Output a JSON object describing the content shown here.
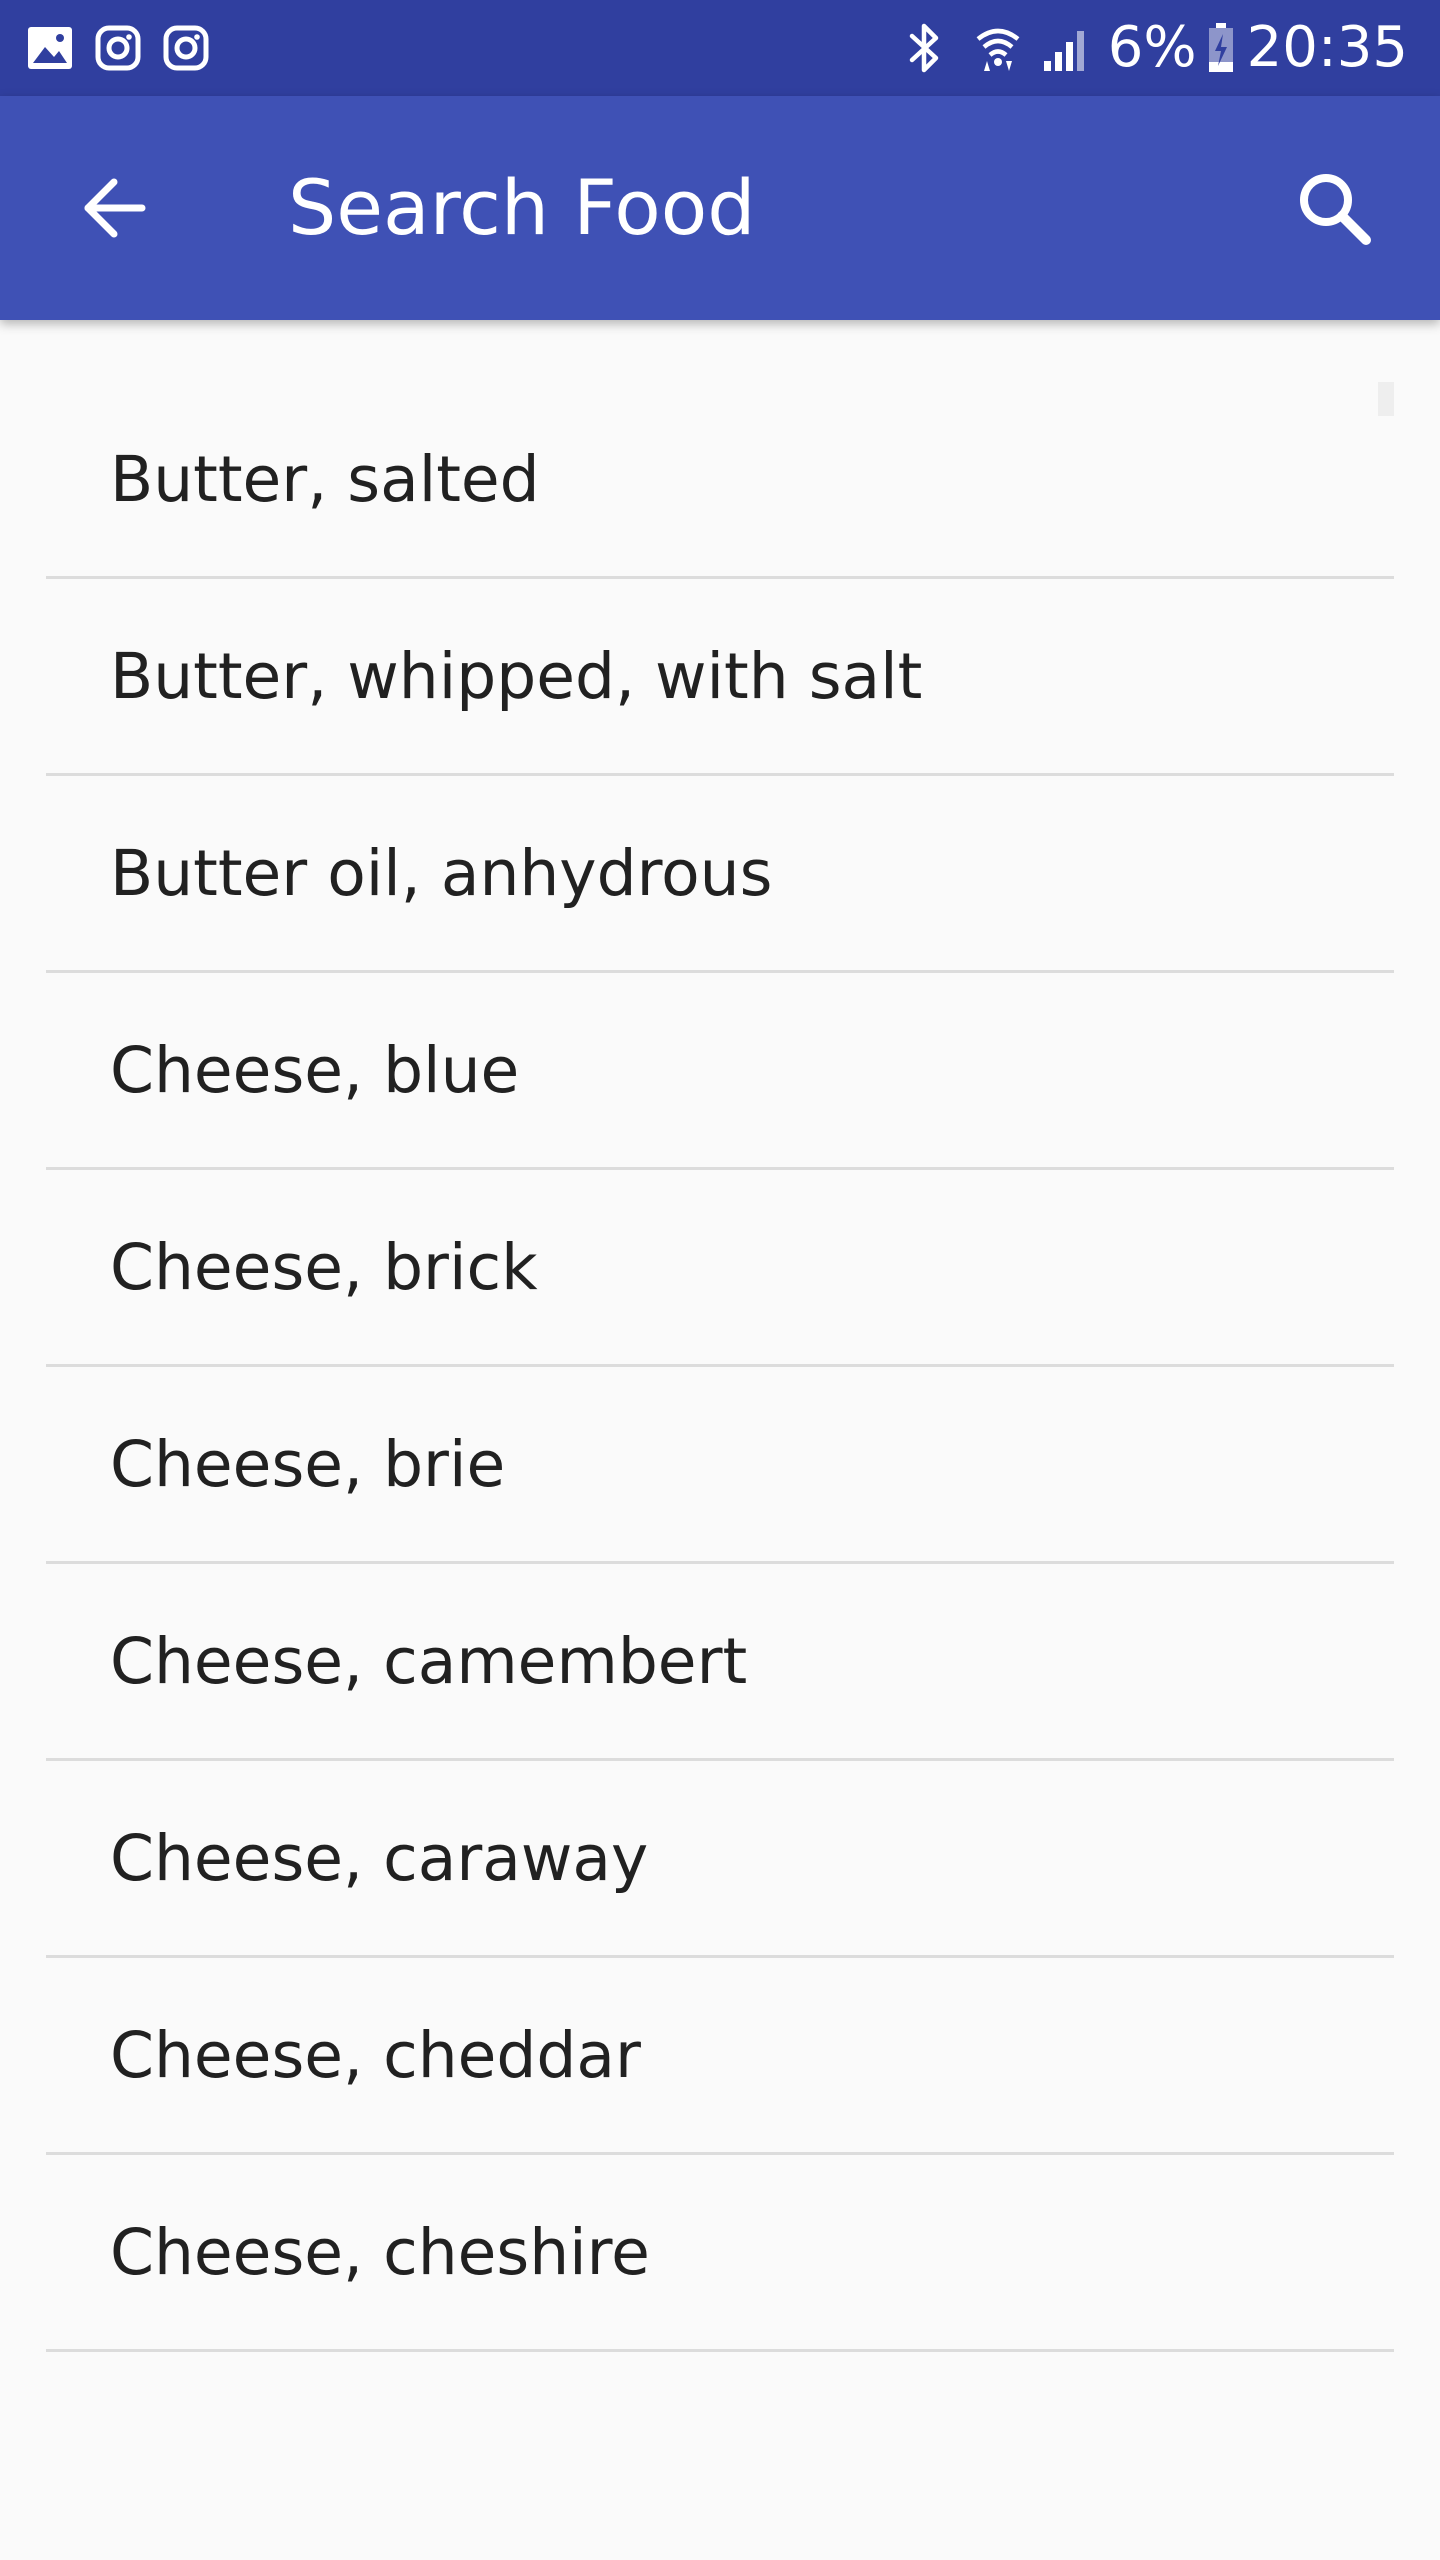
{
  "status_bar": {
    "left_icons": [
      "gallery-icon",
      "instagram-icon",
      "instagram-icon"
    ],
    "right_icons": [
      "bluetooth-icon",
      "wifi-icon",
      "signal-icon",
      "battery-icon"
    ],
    "battery": "6%",
    "time": "20:35"
  },
  "app_bar": {
    "title": "Search Food",
    "background": "#3f51b5",
    "status_background": "#303f9f",
    "back_icon": "arrow-back-icon",
    "search_icon": "search-icon"
  },
  "food_list": {
    "items": [
      {
        "label": "Butter, salted"
      },
      {
        "label": "Butter, whipped, with salt"
      },
      {
        "label": "Butter oil, anhydrous"
      },
      {
        "label": "Cheese, blue"
      },
      {
        "label": "Cheese, brick"
      },
      {
        "label": "Cheese, brie"
      },
      {
        "label": "Cheese, camembert"
      },
      {
        "label": "Cheese, caraway"
      },
      {
        "label": "Cheese, cheddar"
      },
      {
        "label": "Cheese, cheshire"
      }
    ]
  }
}
